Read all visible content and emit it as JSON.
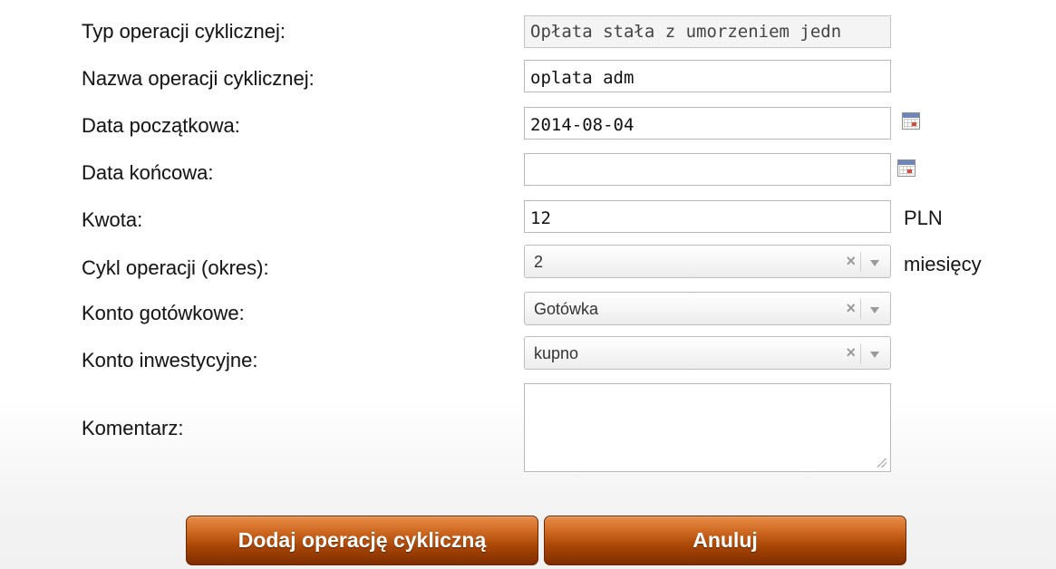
{
  "form": {
    "fields": [
      {
        "label": "Typ operacji cyklicznej:",
        "value": "Opłata stała z umorzeniem jedn"
      },
      {
        "label": "Nazwa operacji cyklicznej:",
        "value": "oplata adm"
      },
      {
        "label": "Data początkowa:",
        "value": "2014-08-04"
      },
      {
        "label": "Data końcowa:",
        "value": ""
      },
      {
        "label": "Kwota:",
        "value": "12",
        "unit": "PLN"
      },
      {
        "label": "Cykl operacji (okres):",
        "value": "2",
        "unit": "miesięcy"
      },
      {
        "label": "Konto gotówkowe:",
        "value": "Gotówka"
      },
      {
        "label": "Konto inwestycyjne:",
        "value": "kupno"
      },
      {
        "label": "Komentarz:",
        "value": ""
      }
    ],
    "clear_glyph": "×",
    "icons": {
      "calendar": "calendar-icon",
      "clear": "clear-icon",
      "dropdown": "chevron-down-icon"
    }
  },
  "buttons": {
    "submit_label": "Dodaj operację cykliczną",
    "cancel_label": "Anuluj"
  },
  "colors": {
    "button": "#a94606",
    "calendar_header": "#6f84b8"
  }
}
